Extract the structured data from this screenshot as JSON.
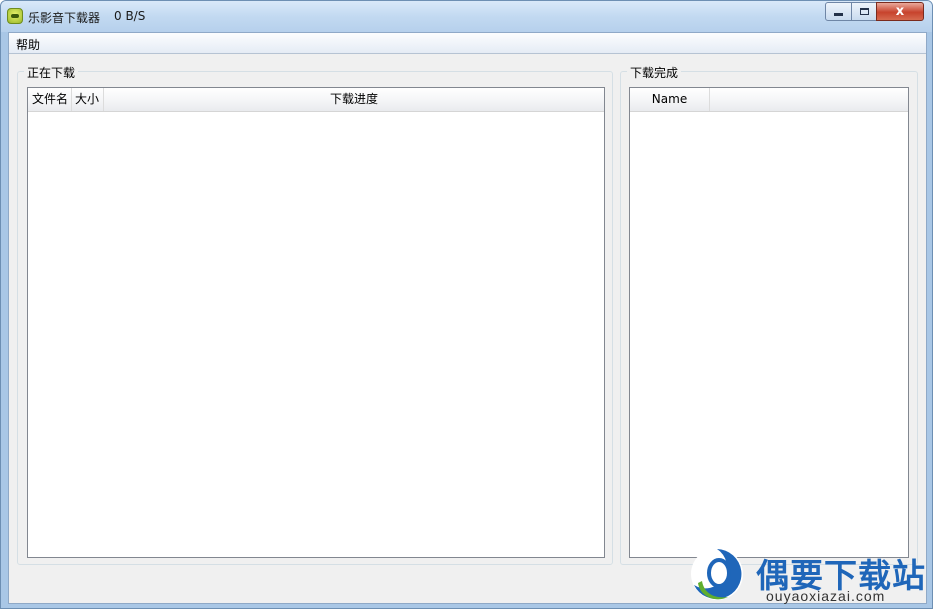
{
  "window": {
    "title": "乐影音下载器",
    "speed": "0 B/S",
    "controls": {
      "close_glyph": "x"
    }
  },
  "menu": {
    "items": [
      "帮助"
    ]
  },
  "downloading": {
    "group_label": "正在下载",
    "columns": [
      "文件名",
      "大小",
      "下载进度"
    ],
    "rows": []
  },
  "completed": {
    "group_label": "下载完成",
    "columns": [
      "Name"
    ],
    "rows": []
  },
  "watermark": {
    "title": "偶要下载站",
    "url": "ouyaoxiazai.com",
    "colors": {
      "accent": "#1f66b9",
      "green": "#5fae2e"
    }
  },
  "icons": {
    "app": "app-logo-icon",
    "minimize": "minimize-icon",
    "maximize": "maximize-icon",
    "close": "close-icon"
  }
}
